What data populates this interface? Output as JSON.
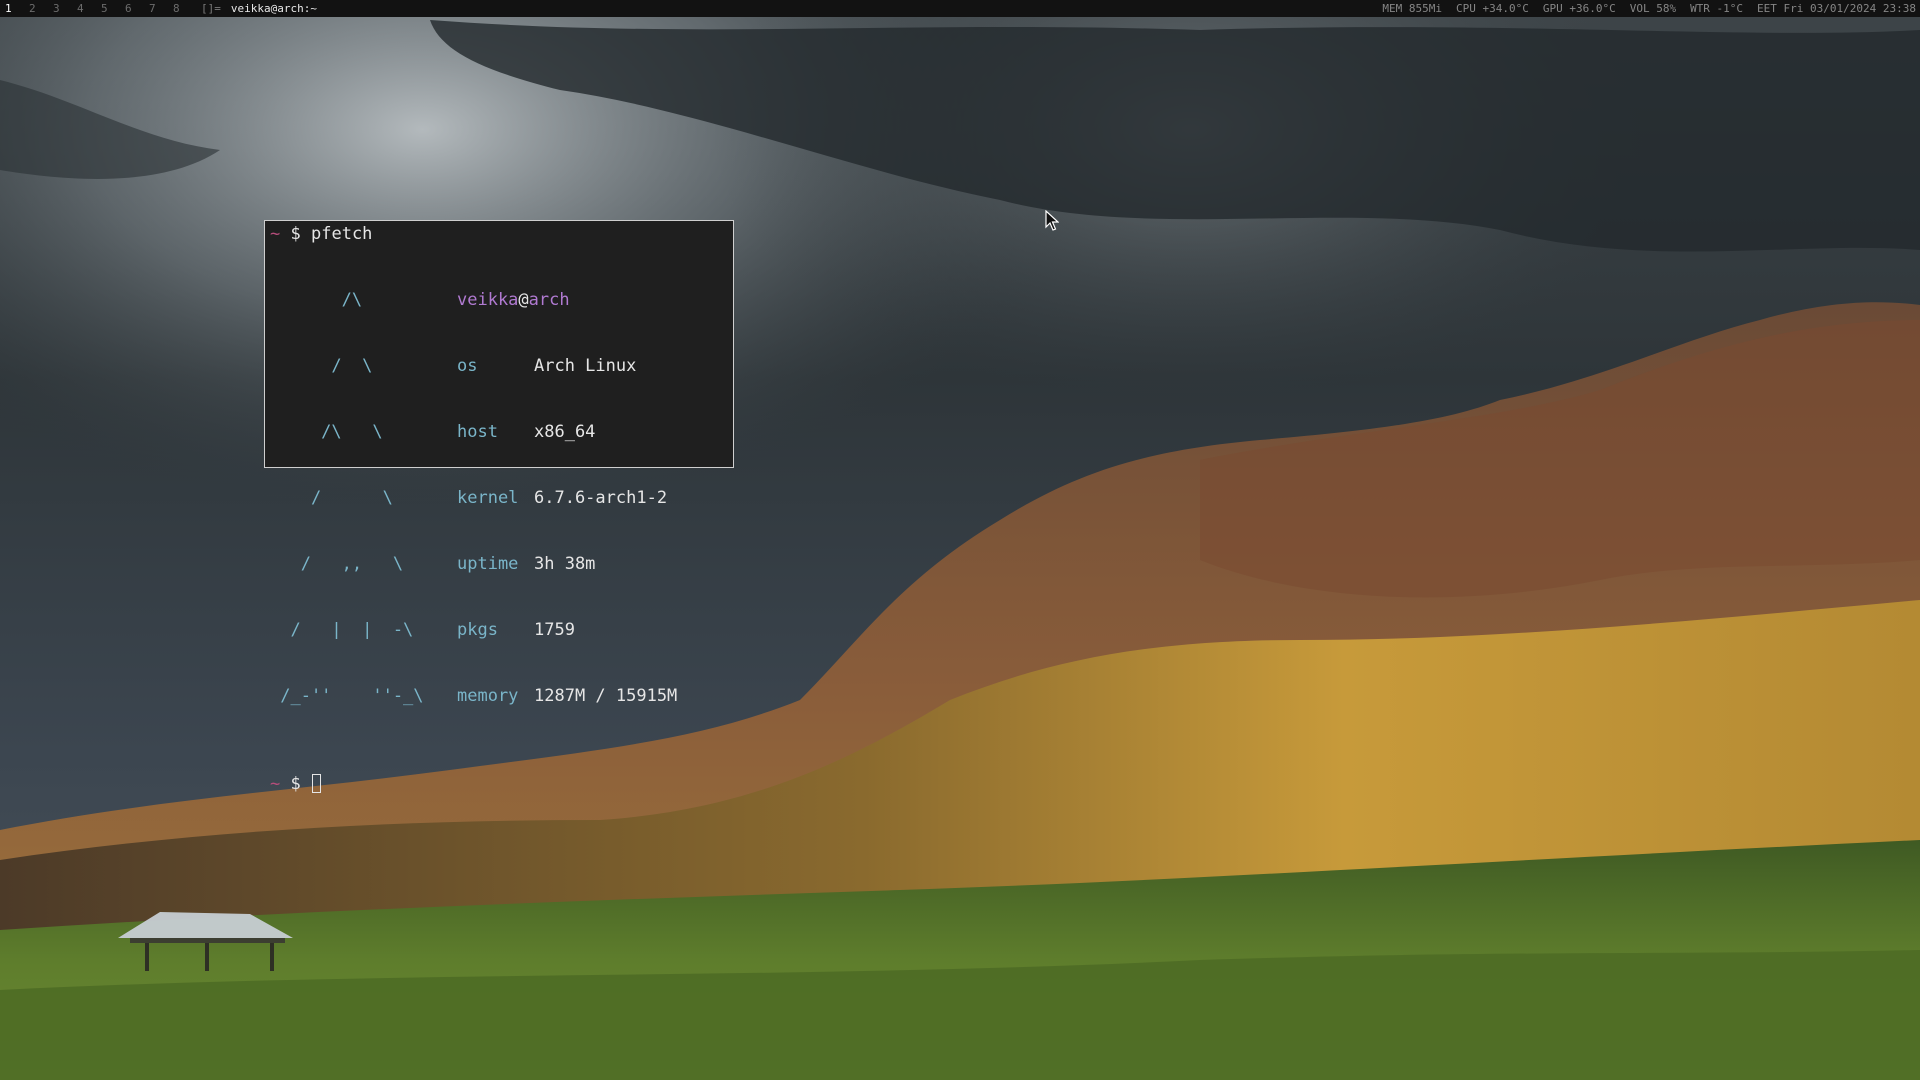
{
  "topbar": {
    "workspaces": [
      "1",
      "2",
      "3",
      "4",
      "5",
      "6",
      "7",
      "8"
    ],
    "active_workspace": "1",
    "layout_indicator": "[]=",
    "window_title": "veikka@arch:~",
    "status": {
      "mem": "MEM 855Mi",
      "cpu": "CPU +34.0°C",
      "gpu": "GPU +36.0°C",
      "vol": "VOL 58%",
      "wtr": "WTR -1°C",
      "clock": "EET Fri 03/01/2024 23:38"
    }
  },
  "terminal": {
    "prompt_symbol": "~",
    "prompt_dollar": "$",
    "command": "pfetch",
    "ascii_art": [
      "       /\\",
      "      /  \\",
      "     /\\   \\",
      "    /      \\",
      "   /   ,,   \\",
      "  /   |  |  -\\",
      " /_-''    ''-_\\"
    ],
    "user": "veikka",
    "at": "@",
    "host": "arch",
    "info": [
      {
        "key": "os",
        "value": "Arch Linux"
      },
      {
        "key": "host",
        "value": "x86_64"
      },
      {
        "key": "kernel",
        "value": "6.7.6-arch1-2"
      },
      {
        "key": "uptime",
        "value": "3h 38m"
      },
      {
        "key": "pkgs",
        "value": "1759"
      },
      {
        "key": "memory",
        "value": "1287M / 15915M"
      }
    ]
  },
  "colors": {
    "bar_bg": "#121212",
    "terminal_bg": "#1f1f1f",
    "accent_cyan": "#7ab5c9",
    "accent_magenta": "#b07ad1",
    "prompt_tilde": "#b64d7b"
  },
  "icons": {
    "pointer": "mouse-pointer-icon"
  }
}
